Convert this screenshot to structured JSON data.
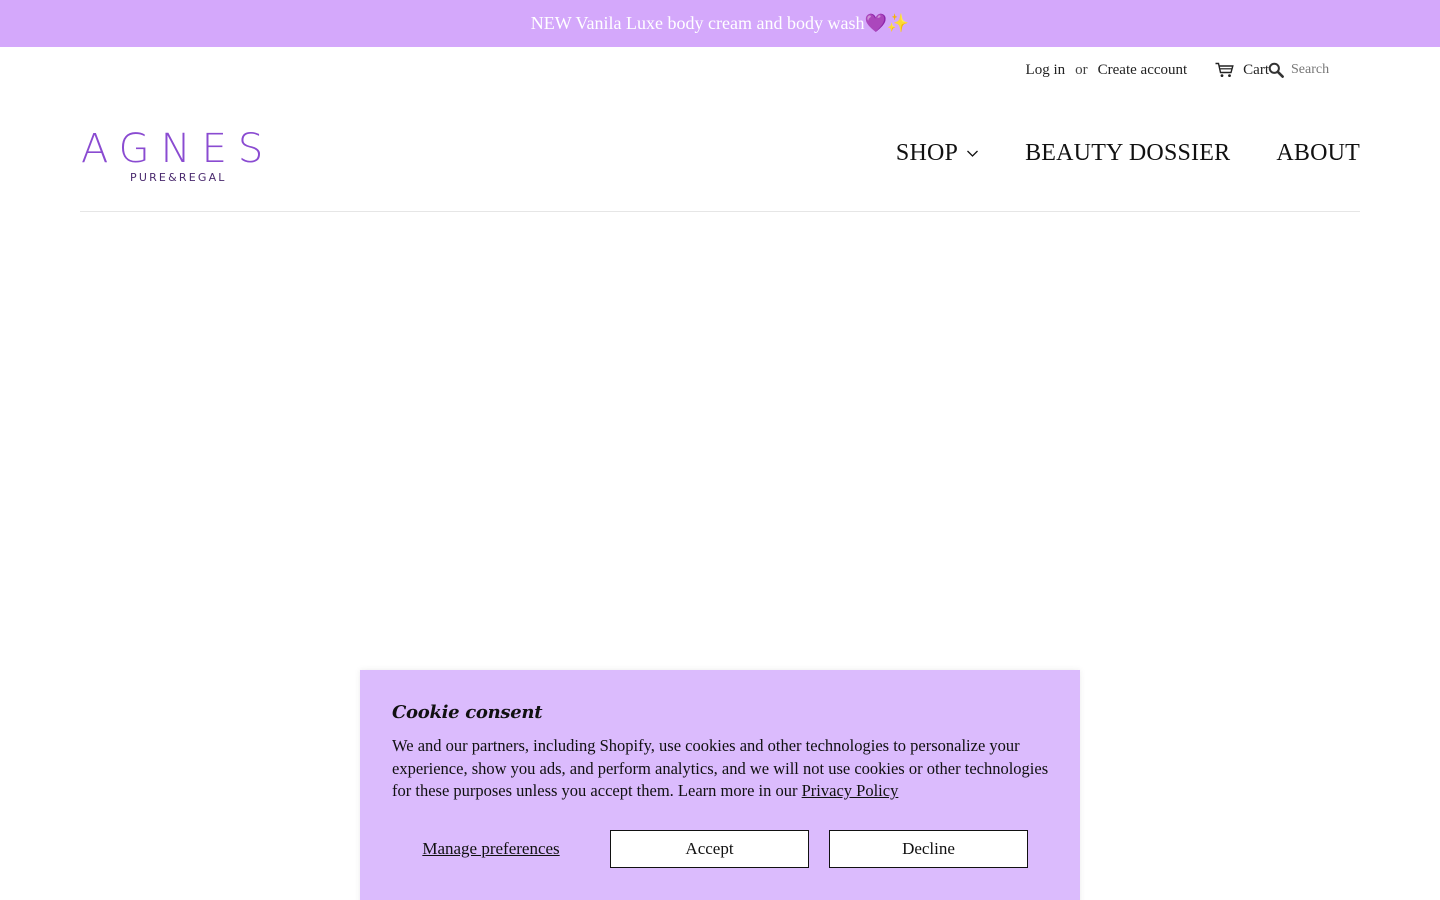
{
  "announcement": {
    "text": "NEW Vanila Luxe body cream and body wash💜✨"
  },
  "utility": {
    "login_label": "Log in",
    "or_text": "or",
    "create_account_label": "Create account",
    "cart_label": "Cart",
    "search_placeholder": "Search"
  },
  "brand": {
    "name": "AGNES",
    "tagline": "PURE&REGAL",
    "color": "#8a4bd1"
  },
  "nav": {
    "items": [
      {
        "label": "SHOP",
        "has_dropdown": true
      },
      {
        "label": "BEAUTY DOSSIER"
      },
      {
        "label": "ABOUT"
      }
    ]
  },
  "cookie_banner": {
    "title": "Cookie consent",
    "body": "We and our partners, including Shopify, use cookies and other technologies to personalize your experience, show you ads, and perform analytics, and we will not use cookies or other technologies for these purposes unless you accept them. Learn more in our ",
    "policy_link": "Privacy Policy",
    "manage_label": "Manage preferences",
    "accept_label": "Accept",
    "decline_label": "Decline",
    "background_color": "#dbbbfd"
  },
  "colors": {
    "announcement_bg": "#d4a8fb"
  }
}
